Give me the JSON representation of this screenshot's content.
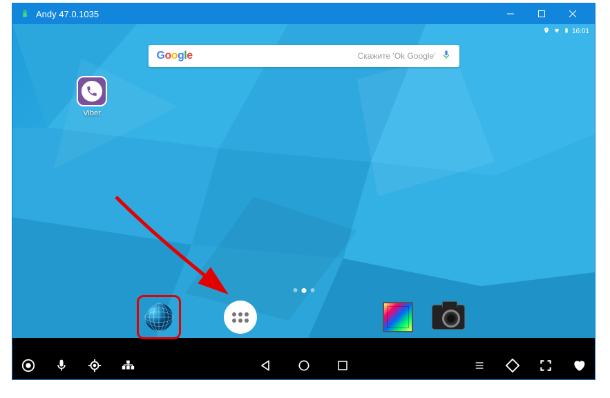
{
  "window": {
    "title": "Andy 47.0.1035"
  },
  "status": {
    "time": "16:01"
  },
  "search": {
    "logo_text": "Google",
    "hint": "Скажите 'Ok Google'"
  },
  "desktop_apps": [
    {
      "name": "viber",
      "label": "Viber"
    }
  ],
  "hotseat": {
    "browser": {
      "name": "browser-app"
    },
    "app_drawer": {
      "name": "app-drawer"
    },
    "gallery": {
      "name": "gallery-app"
    },
    "camera": {
      "name": "camera-app"
    }
  },
  "annotation": {
    "highlight_target": "browser-app"
  }
}
